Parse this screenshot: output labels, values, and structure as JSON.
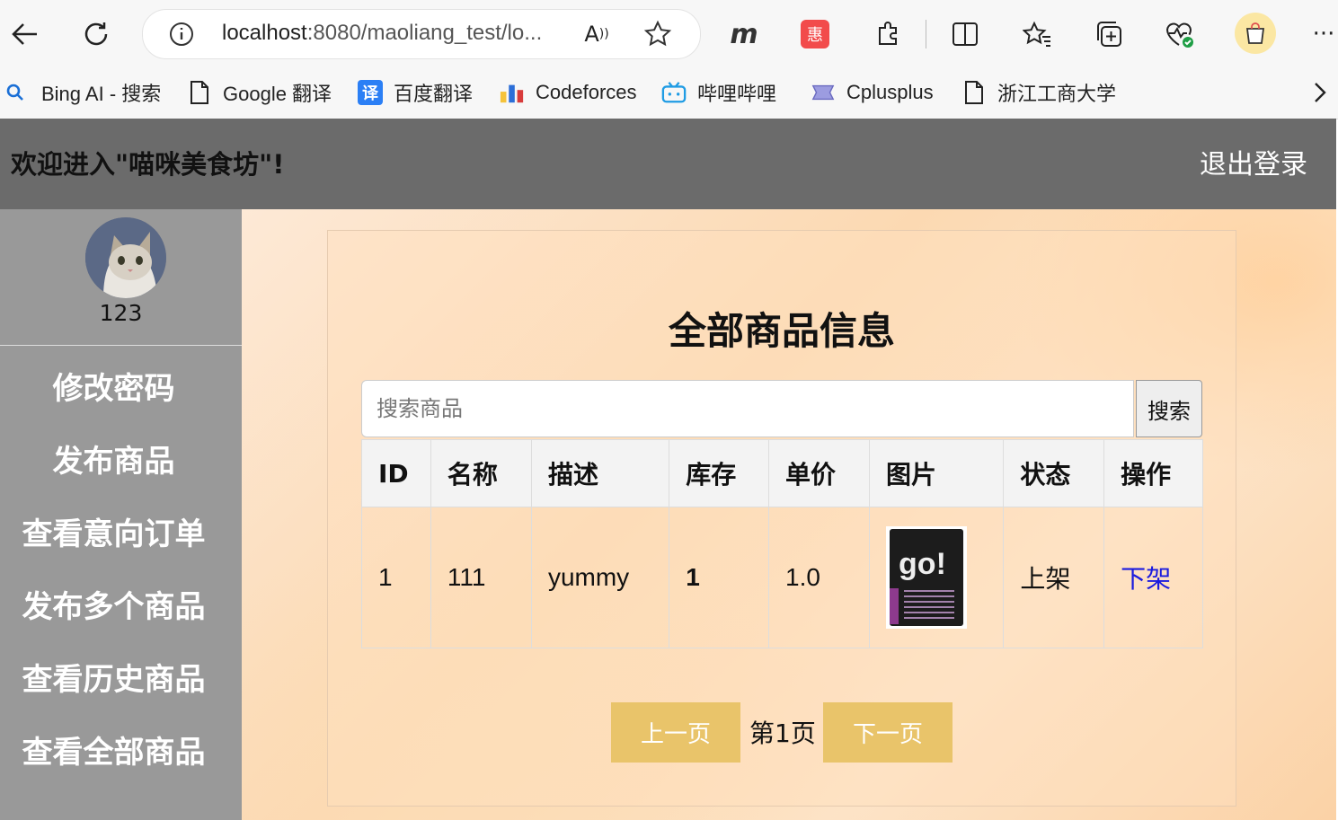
{
  "browser": {
    "url_host": "localhost",
    "url_rest": ":8080/maoliang_test/lo...",
    "bookmarks": [
      {
        "label": "Bing AI - 搜索"
      },
      {
        "label": "Google 翻译"
      },
      {
        "label": "百度翻译"
      },
      {
        "label": "Codeforces"
      },
      {
        "label": "哔哩哔哩"
      },
      {
        "label": "Cplusplus"
      },
      {
        "label": "浙江工商大学"
      }
    ],
    "ext_badge": "惠"
  },
  "header": {
    "title": "欢迎进入\"喵咪美食坊\"!",
    "logout": "退出登录"
  },
  "sidebar": {
    "username": "123",
    "items": [
      {
        "label": "修改密码"
      },
      {
        "label": "发布商品"
      },
      {
        "label": "查看意向订单"
      },
      {
        "label": "发布多个商品"
      },
      {
        "label": "查看历史商品"
      },
      {
        "label": "查看全部商品"
      }
    ]
  },
  "main": {
    "title": "全部商品信息",
    "search_placeholder": "搜索商品",
    "search_button": "搜索",
    "columns": [
      "ID",
      "名称",
      "描述",
      "库存",
      "单价",
      "图片",
      "状态",
      "操作"
    ],
    "rows": [
      {
        "id": "1",
        "name": "111",
        "desc": "yummy",
        "stock": "1",
        "price": "1.0",
        "image_text": "go!",
        "status": "上架",
        "action": "下架"
      }
    ],
    "pager": {
      "prev": "上一页",
      "page": "第1页",
      "next": "下一页"
    }
  },
  "colors": {
    "header_bg": "#6b6b6b",
    "sidebar_bg": "#999999",
    "pager_btn": "#e9c46a",
    "stock_red": "#ee0000",
    "link_blue": "#1a1adf"
  }
}
